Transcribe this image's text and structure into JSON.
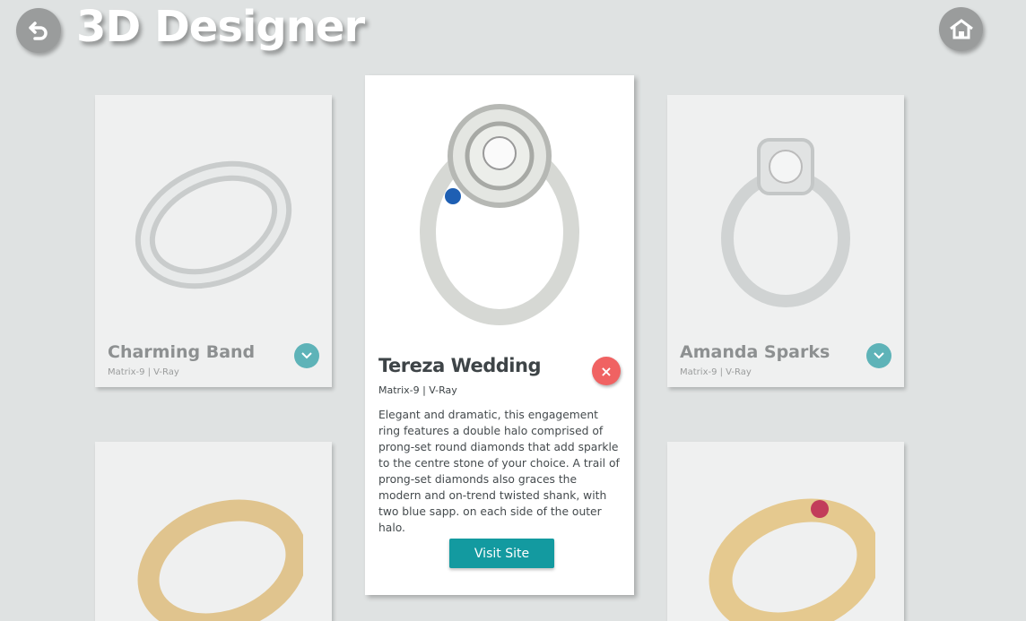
{
  "header": {
    "title": "3D Designer"
  },
  "cards": [
    {
      "name": "Charming Band",
      "sub": "Matrix-9 | V-Ray"
    },
    {
      "name": "Amanda Sparks",
      "sub": "Matrix-9 | V-Ray"
    }
  ],
  "detail": {
    "name": "Tereza Wedding",
    "sub": "Matrix-9 | V-Ray",
    "description": "Elegant and dramatic, this engagement ring features a double halo comprised of prong-set round diamonds that add sparkle to the centre stone of your choice. A trail of prong-set diamonds also graces the modern and on-trend twisted shank, with two blue sapp. on each side of the outer halo.",
    "close": "×",
    "visit_label": "Visit Site"
  },
  "colors": {
    "accent": "#139aa0",
    "close": "#f06262",
    "background": "#dfe2e2"
  }
}
